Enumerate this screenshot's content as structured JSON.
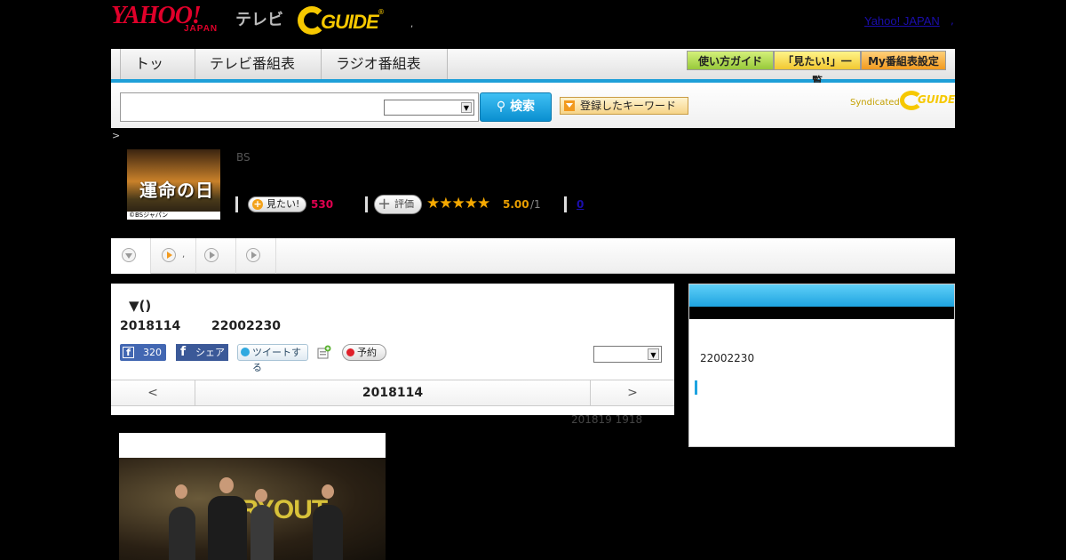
{
  "header": {
    "logo_yahoo": "YAHOO!",
    "logo_japan": "JAPAN",
    "logo_tv": "テレビ",
    "logo_gguide": "GUIDE",
    "link": "Yahoo! JAPAN",
    "dot": ","
  },
  "nav": {
    "items": [
      "トップ",
      "テレビ番組表",
      "ラジオ番組表"
    ],
    "buttons": [
      "使い方ガイド",
      "「見たい!」一覧",
      "My番組表設定"
    ]
  },
  "search": {
    "placeholder": "",
    "button": "検索",
    "keyword_button": "登録したキーワード",
    "syndicated": "Syndicated"
  },
  "breadcrumb": ">",
  "program": {
    "thumb_title": "運命の日",
    "thumb_caption": "©BSジャパン",
    "channel": "BS",
    "watch_label": "見たい!",
    "watch_count": "530",
    "rate_label": "評価",
    "score": "5.00",
    "score_denom": "/1",
    "comments": "0"
  },
  "tabs": {
    "dot": ","
  },
  "main": {
    "title": "▼()",
    "date": "2018114",
    "time": "22002230",
    "fb_count": "320",
    "fb_share": "シェア",
    "tweet": "ツイートする",
    "reserve": "予約",
    "nav_prev": "<",
    "nav_date": "2018114",
    "nav_next": ">",
    "updated": "201819  1918"
  },
  "video": {
    "banner": "TRYOUT"
  },
  "sidebar": {
    "time": "22002230"
  },
  "colors": {
    "accent": "#1e9fd8",
    "star": "#f4a800",
    "count": "#e0004f"
  }
}
